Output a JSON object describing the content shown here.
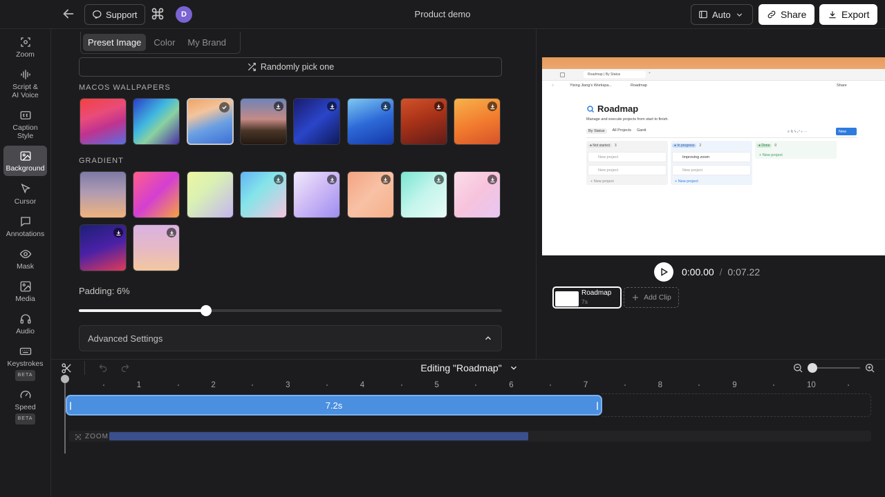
{
  "header": {
    "support_label": "Support",
    "avatar_initial": "D",
    "title": "Product demo",
    "layout_label": "Auto",
    "share_label": "Share",
    "export_label": "Export"
  },
  "sidebar": {
    "items": [
      {
        "label": "Zoom",
        "icon": "zoom-icon"
      },
      {
        "label": "Script &\nAI Voice",
        "icon": "waveform-icon"
      },
      {
        "label": "Caption\nStyle",
        "icon": "caption-icon"
      },
      {
        "label": "Background",
        "icon": "image-icon",
        "active": true
      },
      {
        "label": "Cursor",
        "icon": "cursor-icon"
      },
      {
        "label": "Annotations",
        "icon": "comment-icon"
      },
      {
        "label": "Mask",
        "icon": "eye-icon"
      },
      {
        "label": "Media",
        "icon": "media-icon"
      },
      {
        "label": "Audio",
        "icon": "headphones-icon"
      },
      {
        "label": "Keystrokes",
        "icon": "keyboard-icon",
        "badge": "BETA"
      },
      {
        "label": "Speed",
        "icon": "speedometer-icon",
        "badge": "BETA"
      }
    ]
  },
  "background_panel": {
    "tabs": [
      "Preset Image",
      "Color",
      "My Brand"
    ],
    "active_tab": "Preset Image",
    "random_label": "Randomly pick one",
    "wallpapers_title": "MACOS WALLPAPERS",
    "gradient_title": "GRADIENT",
    "padding_label": "Padding: 6%",
    "padding_value": 0.3,
    "advanced_label": "Advanced Settings"
  },
  "preview": {
    "browser_tab": "Roadmap | By Status",
    "workspace": "Yixing Jiang's Workspa...",
    "page_crumb": "Roadmap",
    "share_text": "Share",
    "roadmap_title": "Roadmap",
    "roadmap_subtitle": "Manage and execute projects from start to finish.",
    "view_tabs": [
      "By Status",
      "All Projects",
      "Gantt"
    ],
    "new_button": "New",
    "columns": [
      {
        "name": "Not started",
        "count": "3",
        "color": "#e6e6e6",
        "cards": [
          "New project",
          "New project"
        ],
        "footer": "New project"
      },
      {
        "name": "In progress",
        "count": "2",
        "color": "#dce9f8",
        "cards": [
          "Improving zoom",
          "New project"
        ],
        "footer": "New project"
      },
      {
        "name": "Done",
        "count": "0",
        "color": "#dcf0e2",
        "cards": [],
        "footer": "New project"
      }
    ],
    "current_time": "0:00.00",
    "separator": "/",
    "total_time": "0:07.22",
    "clip_name": "Roadmap",
    "clip_duration": "7s",
    "add_clip_label": "Add Clip"
  },
  "timeline": {
    "editing_label": "Editing \"Roadmap\"",
    "ticks": [
      "1",
      "2",
      "3",
      "4",
      "5",
      "6",
      "7",
      "8",
      "9",
      "10"
    ],
    "clip_label": "7.2s",
    "zoom_track_label": "ZOOM"
  }
}
